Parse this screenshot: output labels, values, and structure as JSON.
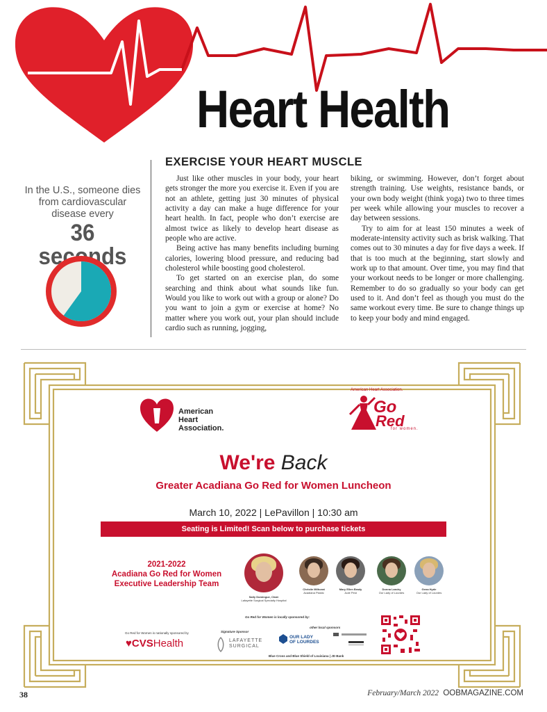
{
  "header": {
    "title": "Heart Health"
  },
  "sidebar": {
    "stat_text": "In the U.S., someone dies from cardiovascular disease every",
    "stat_big": "36 seconds",
    "pie_fraction": 0.6,
    "colors": {
      "ring": "#e02b2b",
      "fill": "#1aa9b5",
      "rest": "#f0ede6"
    }
  },
  "article": {
    "subhead": "EXERCISE YOUR HEART MUSCLE",
    "col1": [
      "Just like other muscles in your body, your heart gets stronger the more you exercise it. Even if you are not an athlete, getting just 30 minutes of physical activity a day can make a huge difference for your heart health. In fact, people who don’t exercise are almost twice as likely to develop heart disease as people who are active.",
      "Being active has many benefits including burning calories, lowering blood pressure, and reducing bad cholesterol while boosting good cholesterol.",
      "To get started on an exercise plan, do some searching and think about what sounds like fun. Would you like to work out with a group or alone? Do you want to join a gym or exercise at home? No matter where you work out, your plan should include cardio such as running, jogging,"
    ],
    "col2": [
      "biking, or swimming. However, don’t forget about strength training. Use weights, resistance bands, or your own body weight (think yoga) two to three times per week while allowing your muscles to recover a day between sessions.",
      "Try to aim for at least 150 minutes a week of moderate-intensity activity such as brisk walking. That comes out to 30 minutes a day for five days a week. If that is too much at the beginning, start slowly and work up to that amount.  Over time, you may find that your workout needs to be longer or more challenging. Remember to do so gradually so your body can get used to it. And don’t feel as though you must do the same workout every time. Be sure to change things up to keep your body and mind engaged."
    ]
  },
  "ad": {
    "aha_logo_text": [
      "American",
      "Heart",
      "Association."
    ],
    "gored_small": "American Heart Association.",
    "gored_go": "Go",
    "gored_red": "Red",
    "gored_forwomen": "for women.",
    "headline_1": "We're",
    "headline_2": "Back",
    "subtitle": "Greater Acadiana Go Red for Women Luncheon",
    "date_line": "March 10, 2022  |  LePavillon  |  10:30 am",
    "bar_text": "Seating is Limited!  Scan below to purchase tickets",
    "team_title": [
      "2021-2022",
      "Acadiana Go Red for Women",
      "Executive Leadership Team"
    ],
    "people": [
      {
        "name": "Sally Domingue, Chair",
        "org": "Lafayette Surgical Specialty Hospital"
      },
      {
        "name": "Christie Milhorat",
        "org": "Acadiana Plastic"
      },
      {
        "name": "Mary Ellen Brady",
        "org": "Jude Pest"
      },
      {
        "name": "Donna Landry",
        "org": "Our Lady of Lourdes"
      },
      {
        "name": "Gena Hyde",
        "org": "Our Lady of Lourdes"
      }
    ],
    "local_sponsor_line": "Go Red for Women is locally sponsored by:",
    "national_line": "Go Red for Women is nationally sponsored by",
    "cvs_logo": "CVS",
    "cvs_health": "Health",
    "signature_label": "Signature Sponsor",
    "laf_logo": [
      "LAFAYETTE",
      "SURGICAL"
    ],
    "other_local": "other local sponsors",
    "lady_logo": [
      "OUR LADY",
      "OF LOURDES"
    ],
    "sponsor_bottom": "Blue Cross and Blue Shield of Louisiana  |  JD Bank",
    "colors": {
      "gold": "#c6ad5c",
      "red": "#c8102e"
    }
  },
  "footer": {
    "page": "38",
    "issue": "February/March 2022",
    "site": "OOBMAGAZINE.COM"
  }
}
